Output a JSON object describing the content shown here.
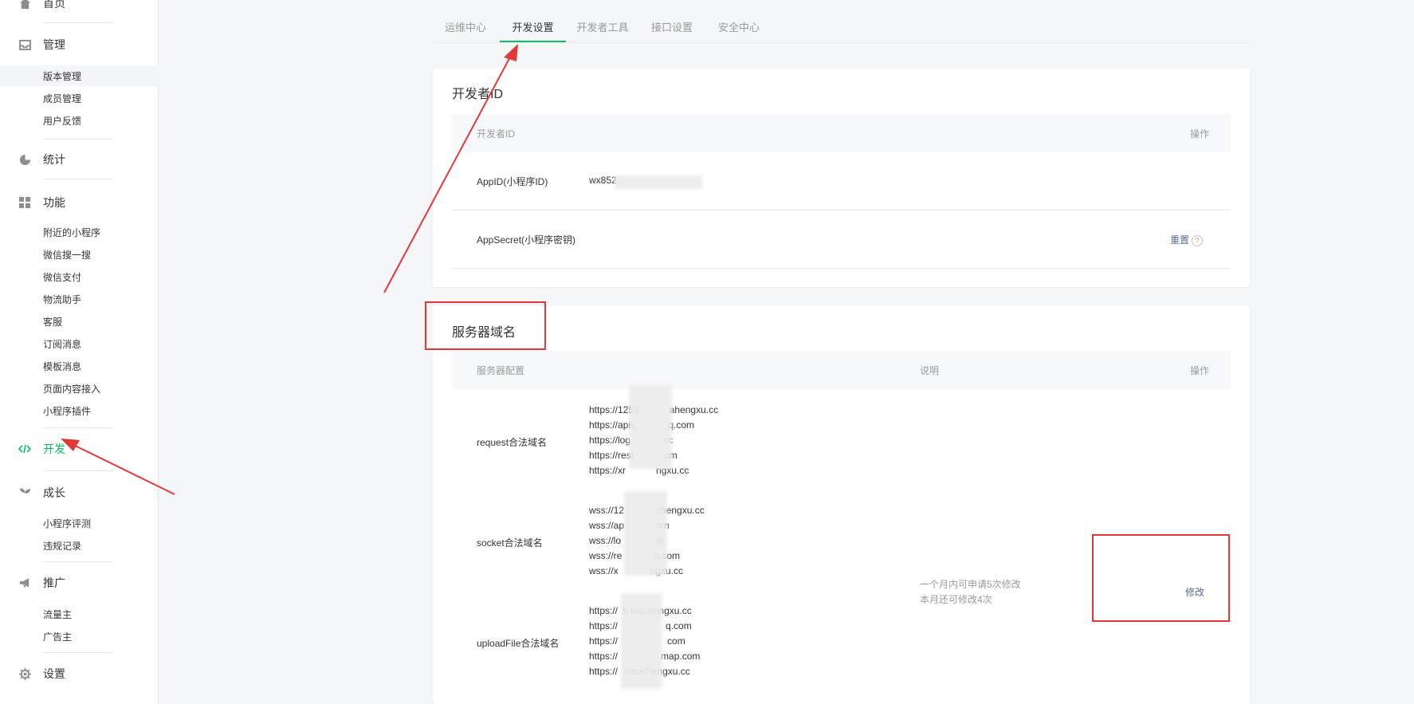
{
  "sidebar": {
    "sections": [
      {
        "label": "首页",
        "icon": "home-icon"
      },
      {
        "label": "管理",
        "icon": "inbox-icon",
        "items": [
          "版本管理",
          "成员管理",
          "用户反馈"
        ]
      },
      {
        "label": "统计",
        "icon": "pie-chart-icon"
      },
      {
        "label": "功能",
        "icon": "grid-icon",
        "items": [
          "附近的小程序",
          "微信搜一搜",
          "微信支付",
          "物流助手",
          "客服",
          "订阅消息",
          "模板消息",
          "页面内容接入",
          "小程序插件"
        ]
      },
      {
        "label": "开发",
        "icon": "code-icon"
      },
      {
        "label": "成长",
        "icon": "sprout-icon",
        "items": [
          "小程序评测",
          "违规记录"
        ]
      },
      {
        "label": "推广",
        "icon": "megaphone-icon",
        "items": [
          "流量主",
          "广告主"
        ]
      },
      {
        "label": "设置",
        "icon": "gear-icon"
      }
    ]
  },
  "tabs": [
    "运维中心",
    "开发设置",
    "开发者工具",
    "接口设置",
    "安全中心"
  ],
  "developer_id": {
    "title": "开发者ID",
    "header_col1": "开发者ID",
    "header_col2": "操作",
    "appid_label": "AppID(小程序ID)",
    "appid_value": "wx852",
    "secret_label": "AppSecret(小程序密钥)",
    "reset_label": "重置",
    "help_glyph": "?"
  },
  "server_domain": {
    "title": "服务器域名",
    "header_col1": "服务器配置",
    "header_col2": "说明",
    "header_col3": "操作",
    "request_label": "request合法域名",
    "request_domains": [
      "https://1259",
      "https://apis.",
      "https://log.",
      "https://rest",
      "https://xr"
    ],
    "request_tails": [
      "ahengxu.cc",
      "q.com",
      "cc",
      "om",
      "ngxu.cc"
    ],
    "socket_label": "socket合法域名",
    "socket_domains": [
      "wss://12",
      "wss://ap",
      "wss://lo",
      "wss://re",
      "wss://x"
    ],
    "socket_tails": [
      "chengxu.cc",
      "om",
      "m",
      "o.com",
      "ngxu.cc"
    ],
    "upload_label": "uploadFile合法域名",
    "upload_domains": [
      "https://",
      "https://",
      "https://",
      "https://",
      "https://"
    ],
    "upload_tails": [
      "5  iaochengxu.cc",
      "q.com",
      "com",
      "map.com",
      "xiaochengxu.cc"
    ],
    "note_line1": "一个月内可申请5次修改",
    "note_line2": "本月还可修改4次",
    "modify_label": "修改"
  },
  "colors": {
    "accent": "#07c160",
    "link": "#576b95",
    "annotation": "#e33838"
  }
}
